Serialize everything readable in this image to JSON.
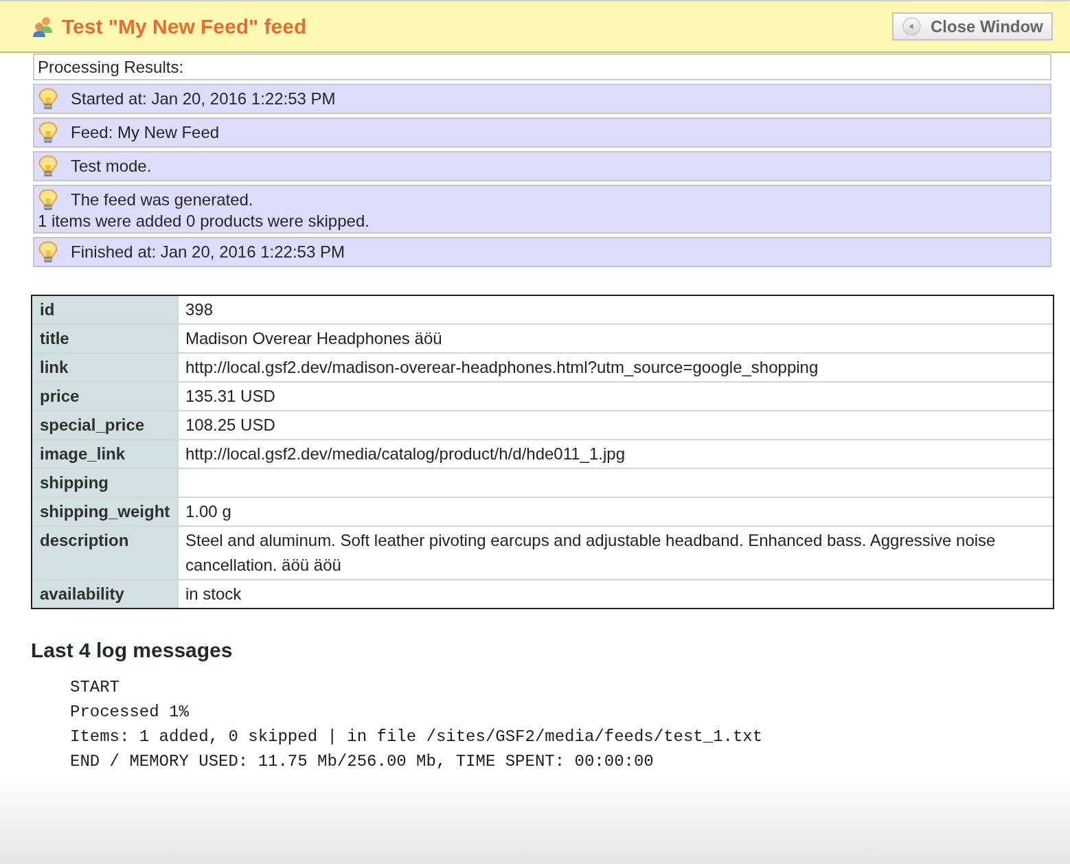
{
  "header": {
    "title": "Test \"My New Feed\" feed",
    "close_button": "Close Window"
  },
  "processing": {
    "heading": "Processing Results:",
    "messages": [
      {
        "lines": [
          "Started at: Jan 20, 2016 1:22:53 PM"
        ]
      },
      {
        "lines": [
          "Feed: My New Feed"
        ]
      },
      {
        "lines": [
          "Test mode."
        ]
      },
      {
        "lines": [
          "The feed was generated.",
          "1 items were added 0 products were skipped."
        ]
      },
      {
        "lines": [
          "Finished at: Jan 20, 2016 1:22:53 PM"
        ]
      }
    ]
  },
  "product_table": {
    "rows": [
      {
        "label": "id",
        "value": "398"
      },
      {
        "label": "title",
        "value": "Madison Overear Headphones äöü"
      },
      {
        "label": "link",
        "value": "http://local.gsf2.dev/madison-overear-headphones.html?utm_source=google_shopping"
      },
      {
        "label": "price",
        "value": "135.31 USD"
      },
      {
        "label": "special_price",
        "value": "108.25 USD"
      },
      {
        "label": "image_link",
        "value": "http://local.gsf2.dev/media/catalog/product/h/d/hde011_1.jpg"
      },
      {
        "label": "shipping"
      },
      {
        "label": "shipping_weight",
        "value": "1.00 g"
      },
      {
        "label": "description",
        "value": "Steel and aluminum. Soft leather pivoting earcups and adjustable headband. Enhanced bass. Aggressive noise cancellation. äöü äöü"
      },
      {
        "label": "availability",
        "value": "in stock"
      }
    ]
  },
  "log": {
    "heading": "Last 4 log messages",
    "lines": [
      "START",
      "Processed 1%",
      "Items: 1 added, 0 skipped | in file /sites/GSF2/media/feeds/test_1.txt",
      "END / MEMORY USED: 11.75 Mb/256.00 Mb, TIME SPENT: 00:00:00"
    ]
  }
}
